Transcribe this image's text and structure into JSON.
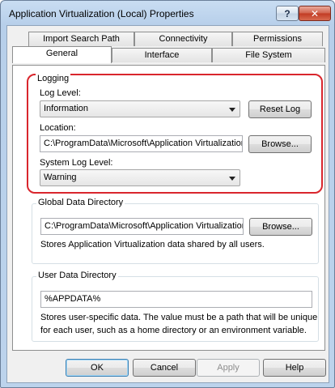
{
  "window": {
    "title": "Application Virtualization (Local) Properties",
    "help_glyph": "?",
    "close_glyph": "✕"
  },
  "tabs": {
    "row1": [
      "Import Search Path",
      "Connectivity",
      "Permissions"
    ],
    "row2": [
      "General",
      "Interface",
      "File System"
    ],
    "active": "General"
  },
  "logging": {
    "group_label": "Logging",
    "log_level_label": "Log Level:",
    "log_level_value": "Information",
    "reset_log": "Reset Log",
    "location_label": "Location:",
    "location_value": "C:\\ProgramData\\Microsoft\\Application Virtualization",
    "browse": "Browse...",
    "system_log_level_label": "System Log Level:",
    "system_log_level_value": "Warning"
  },
  "global_data": {
    "group_label": "Global Data Directory",
    "path_value": "C:\\ProgramData\\Microsoft\\Application Virtualization",
    "browse": "Browse...",
    "description": "Stores Application Virtualization data shared by all users."
  },
  "user_data": {
    "group_label": "User Data Directory",
    "path_value": "%APPDATA%",
    "description_line1": "Stores user-specific data. The value must be a path that will be unique",
    "description_line2": "for each user, such as a home directory or an environment variable."
  },
  "buttons": {
    "ok": "OK",
    "cancel": "Cancel",
    "apply": "Apply",
    "help": "Help"
  },
  "colors": {
    "highlight": "#d9262d",
    "titlebar": "#b7cfea"
  }
}
